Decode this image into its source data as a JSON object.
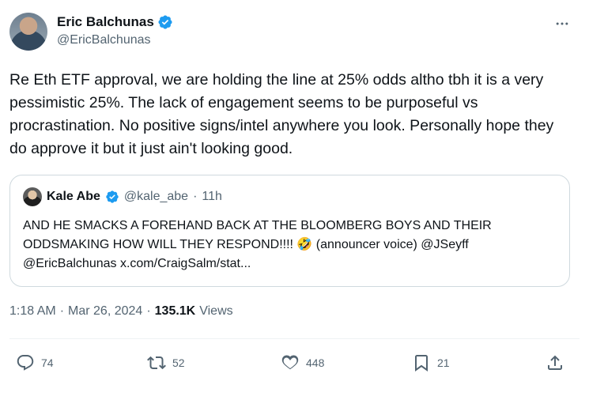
{
  "author": {
    "display_name": "Eric Balchunas",
    "handle": "@EricBalchunas"
  },
  "tweet": {
    "text": "Re Eth ETF approval, we are holding the line at 25% odds altho tbh it is a very pessimistic 25%. The lack of engagement seems to be purposeful vs procrastination. No positive signs/intel anywhere you look. Personally hope they do approve it but it just ain't looking good."
  },
  "quote": {
    "display_name": "Kale Abe",
    "handle": "@kale_abe",
    "separator": "·",
    "time": "11h",
    "text": "AND HE SMACKS A FOREHAND BACK AT THE BLOOMBERG BOYS AND THEIR ODDSMAKING HOW WILL THEY RESPOND!!!! 🤣 (announcer voice) @JSeyff @EricBalchunas x.com/CraigSalm/stat..."
  },
  "meta": {
    "time": "1:18 AM",
    "sep1": "·",
    "date": "Mar 26, 2024",
    "sep2": "·",
    "views_count": "135.1K",
    "views_label": "Views"
  },
  "actions": {
    "replies": "74",
    "reposts": "52",
    "likes": "448",
    "bookmarks": "21"
  },
  "colors": {
    "verified": "#1d9bf0",
    "secondary_text": "#536471",
    "border": "#cfd9de"
  },
  "icons": [
    "verified-badge-icon",
    "more-icon",
    "reply-icon",
    "repost-icon",
    "like-icon",
    "bookmark-icon",
    "share-icon"
  ]
}
